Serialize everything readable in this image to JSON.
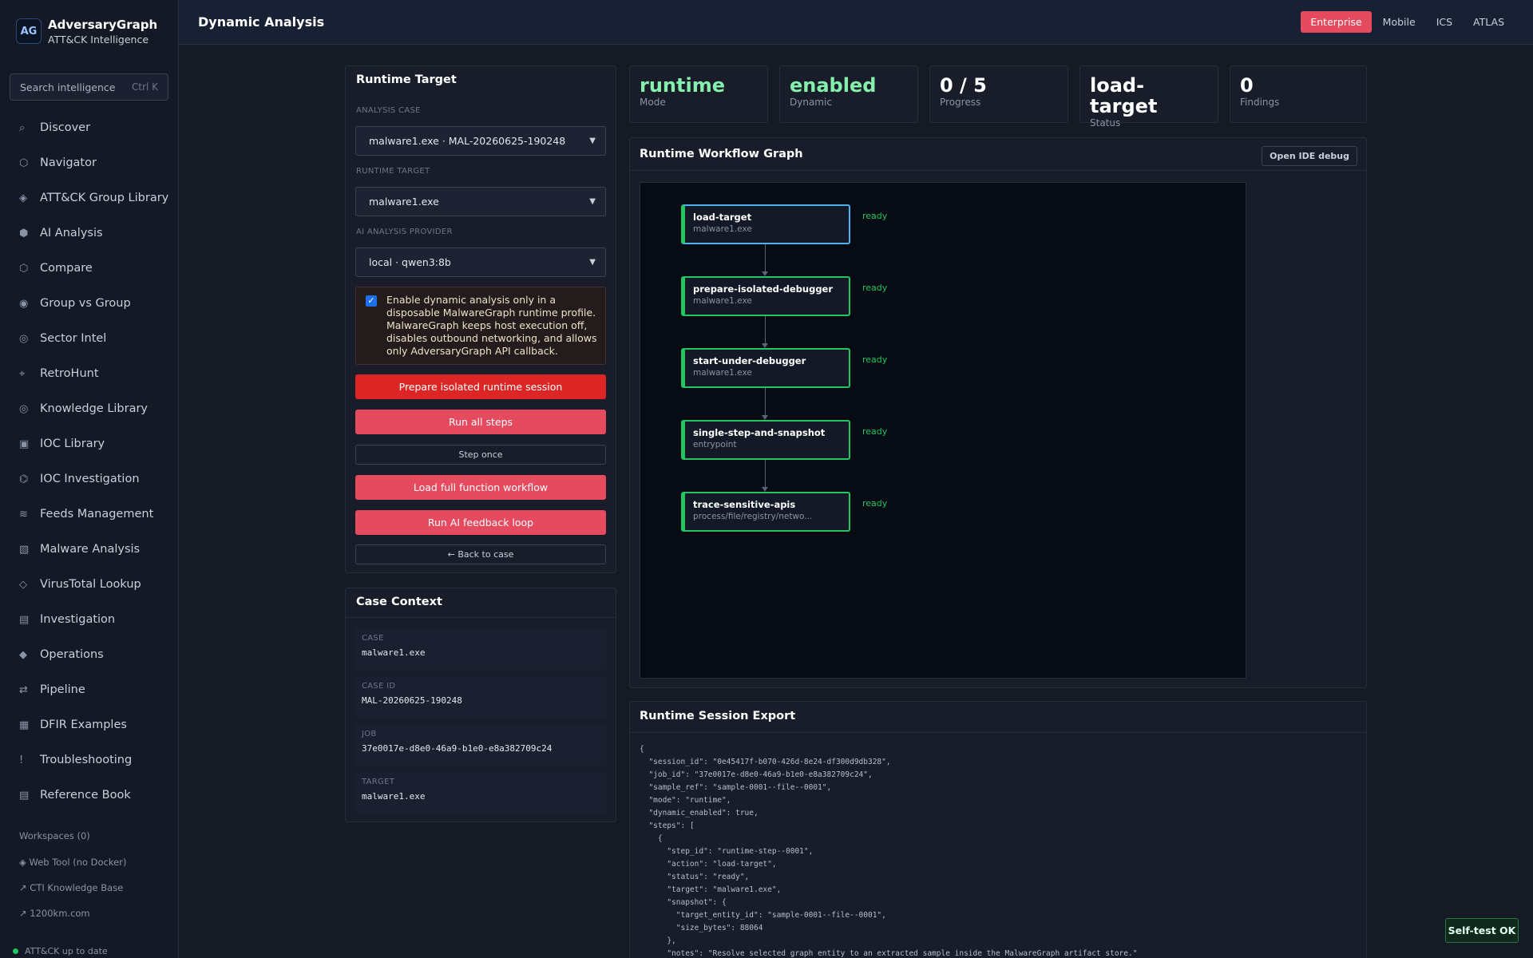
{
  "app": {
    "name": "AdversaryGraph",
    "subtitle": "ATT&CK Intelligence",
    "logo": "AG"
  },
  "sidebar": {
    "search": {
      "placeholder": "Search intelligence",
      "shortcut": "Ctrl K"
    },
    "items": [
      {
        "label": "Discover",
        "icon": "⌕"
      },
      {
        "label": "Navigator",
        "icon": "⬡"
      },
      {
        "label": "ATT&CK Group Library",
        "icon": "◈"
      },
      {
        "label": "AI Analysis",
        "icon": "⬢"
      },
      {
        "label": "Compare",
        "icon": "⬡"
      },
      {
        "label": "Group vs Group",
        "icon": "◉"
      },
      {
        "label": "Sector Intel",
        "icon": "◎"
      },
      {
        "label": "RetroHunt",
        "icon": "⌖"
      },
      {
        "label": "Knowledge Library",
        "icon": "◎"
      },
      {
        "label": "IOC Library",
        "icon": "▣"
      },
      {
        "label": "IOC Investigation",
        "icon": "⌬"
      },
      {
        "label": "Feeds Management",
        "icon": "≋"
      },
      {
        "label": "Malware Analysis",
        "icon": "▧"
      },
      {
        "label": "VirusTotal Lookup",
        "icon": "◇"
      },
      {
        "label": "Investigation",
        "icon": "▤"
      },
      {
        "label": "Operations",
        "icon": "◆"
      },
      {
        "label": "Pipeline",
        "icon": "⇄"
      },
      {
        "label": "DFIR Examples",
        "icon": "▦"
      },
      {
        "label": "Troubleshooting",
        "icon": "!"
      },
      {
        "label": "Reference Book",
        "icon": "▤"
      }
    ],
    "workspaces_title": "Workspaces (0)",
    "workspaces": [
      "◈ Web Tool (no Docker)",
      "↗ CTI Knowledge Base",
      "↗ 1200km.com"
    ],
    "status": "ATT&CK up to date"
  },
  "header": {
    "title": "Dynamic Analysis",
    "matrices": [
      "Enterprise",
      "Mobile",
      "ICS",
      "ATLAS"
    ],
    "active_matrix": "Enterprise"
  },
  "runtime_target": {
    "title": "Runtime Target",
    "analysis_case_label": "ANALYSIS CASE",
    "analysis_case_value": "malware1.exe · MAL-20260625-190248",
    "runtime_target_label": "RUNTIME TARGET",
    "runtime_target_value": "malware1.exe",
    "provider_label": "AI ANALYSIS PROVIDER",
    "provider_value": "local · qwen3:8b",
    "consent_text": "Enable dynamic analysis only in a disposable MalwareGraph runtime profile. MalwareGraph keeps host execution off, disables outbound networking, and allows only AdversaryGraph API callback.",
    "consent_checked": true,
    "buttons": {
      "prepare": "Prepare isolated runtime session",
      "run_all": "Run all steps",
      "step_once": "Step once",
      "load_workflow": "Load full function workflow",
      "feedback": "Run AI feedback loop",
      "back": "← Back to case"
    }
  },
  "case_context": {
    "title": "Case Context",
    "fields": [
      {
        "key": "CASE",
        "value": "malware1.exe"
      },
      {
        "key": "CASE ID",
        "value": "MAL-20260625-190248"
      },
      {
        "key": "JOB",
        "value": "37e0017e-d8e0-46a9-b1e0-e8a382709c24"
      },
      {
        "key": "TARGET",
        "value": "malware1.exe"
      }
    ]
  },
  "stats": [
    {
      "value": "runtime",
      "label": "Mode",
      "color": "#86efac"
    },
    {
      "value": "enabled",
      "label": "Dynamic",
      "color": "#86efac"
    },
    {
      "value": "0 / 5",
      "label": "Progress",
      "color": "#ffffff"
    },
    {
      "value": "load-target",
      "label": "Status",
      "color": "#ffffff"
    },
    {
      "value": "0",
      "label": "Findings",
      "color": "#ffffff"
    }
  ],
  "graph": {
    "title": "Runtime Workflow Graph",
    "ide_button": "Open IDE debug",
    "nodes": [
      {
        "title": "load-target",
        "subtitle": "malware1.exe",
        "status": "ready",
        "selected": true
      },
      {
        "title": "prepare-isolated-debugger",
        "subtitle": "malware1.exe",
        "status": "ready",
        "selected": false
      },
      {
        "title": "start-under-debugger",
        "subtitle": "malware1.exe",
        "status": "ready",
        "selected": false
      },
      {
        "title": "single-step-and-snapshot",
        "subtitle": "entrypoint",
        "status": "ready",
        "selected": false
      },
      {
        "title": "trace-sensitive-apis",
        "subtitle": "process/file/registry/netwo...",
        "status": "ready",
        "selected": false
      }
    ]
  },
  "export": {
    "title": "Runtime Session Export",
    "json_lines": [
      "{",
      "  \"session_id\": \"0e45417f-b070-426d-8e24-df300d9db328\",",
      "  \"job_id\": \"37e0017e-d8e0-46a9-b1e0-e8a382709c24\",",
      "  \"sample_ref\": \"sample-0001--file--0001\",",
      "  \"mode\": \"runtime\",",
      "  \"dynamic_enabled\": true,",
      "  \"steps\": [",
      "    {",
      "      \"step_id\": \"runtime-step--0001\",",
      "      \"action\": \"load-target\",",
      "      \"status\": \"ready\",",
      "      \"target\": \"malware1.exe\",",
      "      \"snapshot\": {",
      "        \"target_entity_id\": \"sample-0001--file--0001\",",
      "        \"size_bytes\": 88064",
      "      },",
      "      \"notes\": \"Resolve selected graph entity to an extracted sample inside the MalwareGraph artifact store.\""
    ]
  },
  "selftest": "Self-test OK"
}
